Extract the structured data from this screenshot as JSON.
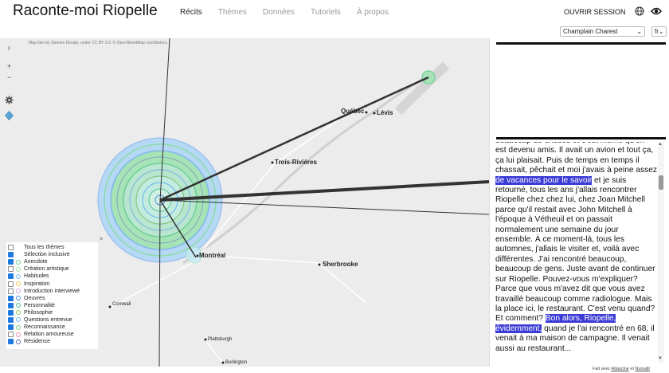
{
  "header": {
    "brand": "Raconte-moi Riopelle",
    "nav": [
      "Récits",
      "Thèmes",
      "Données",
      "Tutoriels",
      "À propos"
    ],
    "open_session": "OUVRIR SESSION"
  },
  "selects": {
    "person": "Champlain Charest",
    "lang": "fr"
  },
  "map": {
    "attribution": "Map tiles by Stamen Design, under CC BY 3.0. © OpenStreetMap contributors.",
    "zoom_in": "+",
    "zoom_out": "−",
    "places": [
      "Québec",
      "Lévis",
      "Trois-Rivières",
      "Montréal",
      "Sherbrooke",
      "Cornwall",
      "Plattsburgh",
      "Burlington"
    ]
  },
  "legend": [
    {
      "label": "Tous les thèmes",
      "checked": false,
      "color": ""
    },
    {
      "label": "Sélection inclusive",
      "checked": true,
      "color": ""
    },
    {
      "label": "Anecdote",
      "checked": true,
      "color": "#6fcf97"
    },
    {
      "label": "Création artistique",
      "checked": false,
      "color": "#a6e3a1"
    },
    {
      "label": "Habitudes",
      "checked": true,
      "color": "#7fb7e8"
    },
    {
      "label": "Inspiration",
      "checked": false,
      "color": "#f2c94c"
    },
    {
      "label": "Introduction interviewé",
      "checked": false,
      "color": "#cfa6e8"
    },
    {
      "label": "Oeuvres",
      "checked": true,
      "color": "#4a8fe0"
    },
    {
      "label": "Personnalité",
      "checked": true,
      "color": "#56c596"
    },
    {
      "label": "Philosophie",
      "checked": true,
      "color": "#8bc34a"
    },
    {
      "label": "Questions entrevue",
      "checked": true,
      "color": "#64b5f6"
    },
    {
      "label": "Reconnaissance",
      "checked": true,
      "color": "#81c784"
    },
    {
      "label": "Relation amoureuse",
      "checked": false,
      "color": "#f48fb1"
    },
    {
      "label": "Résidence",
      "checked": true,
      "color": "#5c6bc0"
    }
  ],
  "transcript": {
    "before": "beaucoup de choses et c'est même qu'on est devenu amis. Il avait un avion et tout ça, ça lui plaisait. Puis de temps en temps il chassait, pêchait et moi j'avais à peine assez ",
    "hl1": "de vacances pour le savoir",
    "middle": " et je suis retourné, tous les ans j'allais rencontrer Riopelle chez chez lui, chez Joan Mitchell parce qu'il restait avec John Mitchell à l'époque à Vétheuil et on passait normalement une semaine du jour ensemble. À ce moment-là, tous les automnes, j'allais le visiter et, voilà avec différentes. J'ai rencontré beaucoup, beaucoup de gens. Juste avant de continuer sur Riopelle. Pouvez-vous m'expliquer? Parce que vous m'avez dit que vous avez travaillé beaucoup comme radiologue. Mais la place ici, le restaurant. C'est venu quand? Et comment? ",
    "hl2": "Bon alors, Riopelle, évidemment,",
    "after": " quand je l'ai rencontré en 68, il venait à ma maison de campagne. Il venait aussi au restaurant..."
  },
  "footer": {
    "prefix": "Fait avec ",
    "link1": "Atlascine",
    "mid": " et ",
    "link2": "Nunaliit"
  }
}
